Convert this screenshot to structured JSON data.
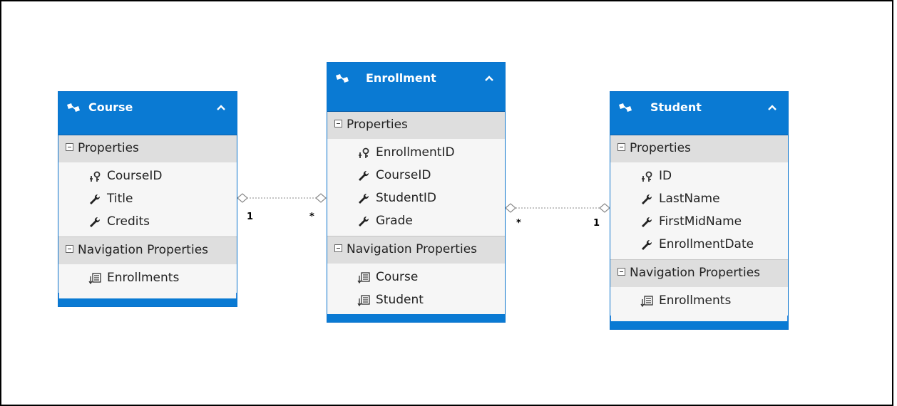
{
  "entities": [
    {
      "name": "Course",
      "properties": [
        {
          "name": "CourseID",
          "kind": "key"
        },
        {
          "name": "Title",
          "kind": "property"
        },
        {
          "name": "Credits",
          "kind": "property"
        }
      ],
      "navigation": [
        {
          "name": "Enrollments"
        }
      ]
    },
    {
      "name": "Enrollment",
      "properties": [
        {
          "name": "EnrollmentID",
          "kind": "key"
        },
        {
          "name": "CourseID",
          "kind": "property"
        },
        {
          "name": "StudentID",
          "kind": "property"
        },
        {
          "name": "Grade",
          "kind": "property"
        }
      ],
      "navigation": [
        {
          "name": "Course"
        },
        {
          "name": "Student"
        }
      ]
    },
    {
      "name": "Student",
      "properties": [
        {
          "name": "ID",
          "kind": "key"
        },
        {
          "name": "LastName",
          "kind": "property"
        },
        {
          "name": "FirstMidName",
          "kind": "property"
        },
        {
          "name": "EnrollmentDate",
          "kind": "property"
        }
      ],
      "navigation": [
        {
          "name": "Enrollments"
        }
      ]
    }
  ],
  "section_labels": {
    "properties": "Properties",
    "navigation": "Navigation Properties"
  },
  "associations": [
    {
      "from": "Course",
      "to": "Enrollment",
      "from_multiplicity": "1",
      "to_multiplicity": "*"
    },
    {
      "from": "Enrollment",
      "to": "Student",
      "from_multiplicity": "*",
      "to_multiplicity": "1"
    }
  ],
  "colors": {
    "header": "#0a7ad3",
    "section": "#dedede",
    "body": "#f6f6f6",
    "link": "#8a8a8a"
  },
  "icons": {
    "entity": "entity-type-icon",
    "key": "key-property-icon",
    "property": "wrench-property-icon",
    "navigation": "navigation-property-icon",
    "collapse": "chevron-up-icon",
    "section_toggle": "collapse-minus-icon"
  }
}
